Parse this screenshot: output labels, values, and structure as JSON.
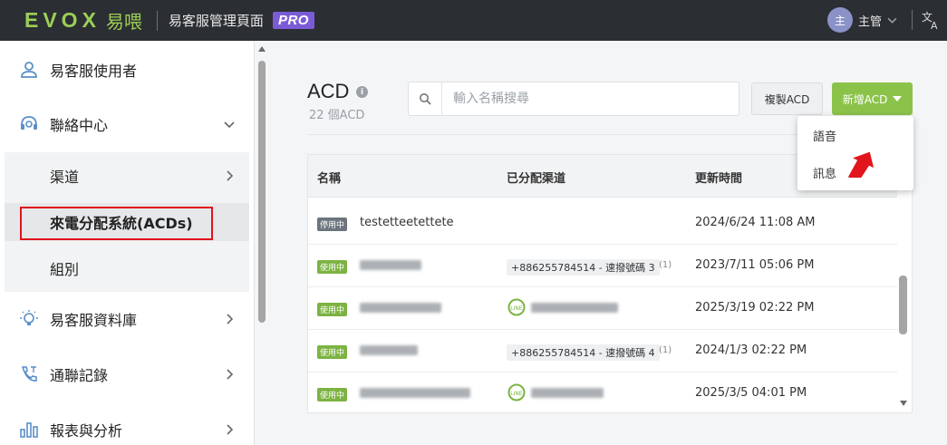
{
  "header": {
    "logo_text": "EVOX",
    "logo_cn": "易喂",
    "app_title": "易客服管理頁面",
    "pro_badge": "PRO",
    "user_avatar": "主",
    "user_name": "主管"
  },
  "sidebar": {
    "items": [
      {
        "label": "易客服使用者",
        "icon": "user-icon"
      },
      {
        "label": "聯絡中心",
        "icon": "headset-icon"
      },
      {
        "label": "渠道",
        "icon": ""
      },
      {
        "label": "來電分配系統(ACDs)",
        "icon": ""
      },
      {
        "label": "組別",
        "icon": ""
      },
      {
        "label": "易客服資料庫",
        "icon": "lightbulb-icon"
      },
      {
        "label": "通聯記錄",
        "icon": "phone-log-icon"
      },
      {
        "label": "報表與分析",
        "icon": "bar-chart-icon"
      }
    ]
  },
  "main": {
    "title": "ACD",
    "info_glyph": "i",
    "count": "22 個ACD",
    "search_placeholder": "輸入名稱搜尋",
    "copy_button": "複製ACD",
    "add_button": "新增ACD",
    "dropdown": [
      "語音",
      "訊息"
    ],
    "table": {
      "headers": [
        "名稱",
        "已分配渠道",
        "更新時間"
      ],
      "rows": [
        {
          "status": "停用中",
          "name": "testetteetettete",
          "channel": "",
          "channel_count": "",
          "time": "2024/6/24 11:08 AM"
        },
        {
          "status": "使用中",
          "name": "",
          "channel": "+886255784514 - 速撥號碼 3",
          "channel_count": "(1)",
          "time": "2023/7/11 05:06 PM"
        },
        {
          "status": "使用中",
          "name": "",
          "channel": "",
          "channel_count": "",
          "time": "2025/3/19 02:22 PM"
        },
        {
          "status": "使用中",
          "name": "",
          "channel": "+886255784514 - 速撥號碼 4",
          "channel_count": "(1)",
          "time": "2024/1/3 02:22 PM"
        },
        {
          "status": "使用中",
          "name": "",
          "channel": "",
          "channel_count": "",
          "time": "2025/3/5 04:01 PM"
        }
      ]
    }
  },
  "colors": {
    "topbar": "#2b2f33",
    "brand_green": "#9ccf56",
    "accent_green": "#8bc34a",
    "pro_purple": "#7b5cd6",
    "highlight_red": "#e2141c"
  }
}
